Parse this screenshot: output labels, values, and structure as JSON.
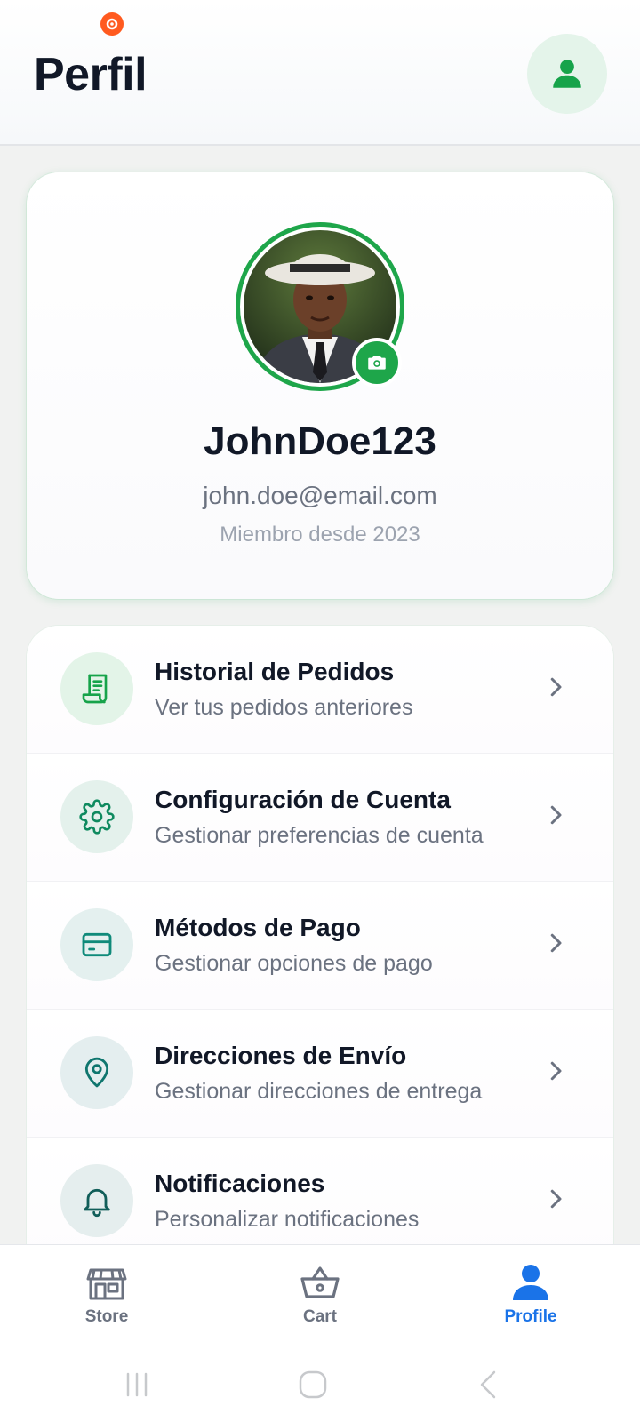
{
  "header": {
    "title": "Perfil",
    "status_icon": "app-notification-icon",
    "avatar_icon": "user-icon"
  },
  "profile": {
    "username": "JohnDoe123",
    "email": "john.doe@email.com",
    "member_since": "Miembro desde 2023",
    "camera_icon": "camera-icon"
  },
  "menu": {
    "items": [
      {
        "title": "Historial de Pedidos",
        "subtitle": "Ver tus pedidos anteriores",
        "icon": "receipt-icon"
      },
      {
        "title": "Configuración de Cuenta",
        "subtitle": "Gestionar preferencias de cuenta",
        "icon": "gear-icon"
      },
      {
        "title": "Métodos de Pago",
        "subtitle": "Gestionar opciones de pago",
        "icon": "credit-card-icon"
      },
      {
        "title": "Direcciones de Envío",
        "subtitle": "Gestionar direcciones de entrega",
        "icon": "location-pin-icon"
      },
      {
        "title": "Notificaciones",
        "subtitle": "Personalizar notificaciones",
        "icon": "bell-icon"
      }
    ]
  },
  "nav": {
    "store": "Store",
    "cart": "Cart",
    "profile": "Profile",
    "active": "Profile"
  },
  "colors": {
    "accent_green": "#1ea64a",
    "nav_active_blue": "#1a73e8",
    "background": "#f1f2f1"
  }
}
